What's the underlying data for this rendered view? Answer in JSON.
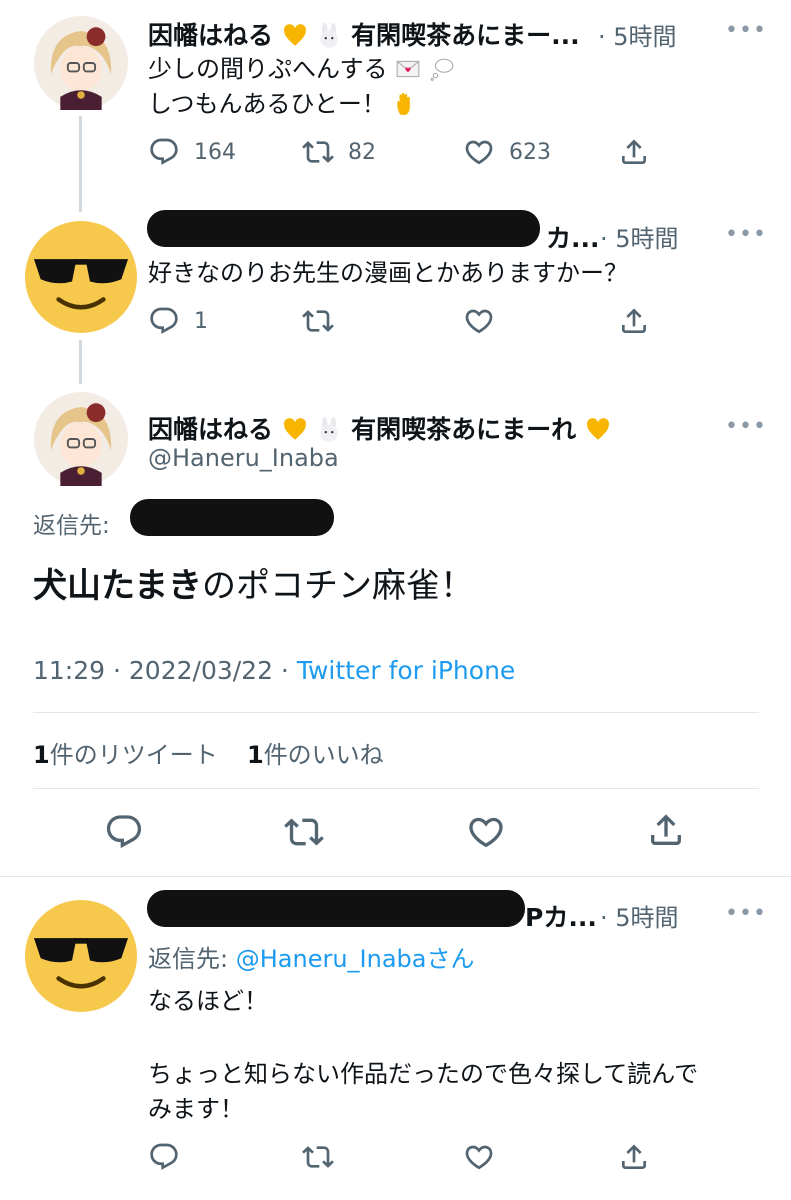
{
  "tweet1": {
    "name": "因幡はねる",
    "name_rest": "有閑喫茶あにまー...",
    "time": "· 5時間",
    "line1": "少しの間りぷへんする",
    "line2": "しつもんあるひとー！",
    "reply_count": "164",
    "retweet_count": "82",
    "like_count": "623"
  },
  "tweet2": {
    "name_suffix": "カ...",
    "time": "· 5時間",
    "text": "好きなのりお先生の漫画とかありますかー？",
    "reply_count": "1"
  },
  "main_tweet": {
    "name": "因幡はねる",
    "name_rest": "有閑喫茶あにまーれ",
    "handle": "@Haneru_Inaba",
    "reply_to_label": "返信先:",
    "text_bold": "犬山たまき",
    "text_rest": "のポコチン麻雀！",
    "time": "11:29",
    "date": "· 2022/03/22 ·",
    "source": "Twitter for iPhone",
    "retweets_num": "1",
    "retweets_label": "件のリツイート",
    "likes_num": "1",
    "likes_label": "件のいいね"
  },
  "tweet4": {
    "name_suffix": "Pカ...",
    "time": "· 5時間",
    "reply_to_label": "返信先:",
    "reply_to_handle": "@Haneru_Inaba",
    "reply_to_suffix": "さん",
    "line1": "なるほど！",
    "line2": "ちょっと知らない作品だったので色々探して読んで",
    "line3": "みます！"
  },
  "more_glyph": "•••",
  "colors": {
    "link": "#1d9bf0",
    "muted": "#536471",
    "heart": "#f7b500",
    "redacted": "#111111"
  }
}
